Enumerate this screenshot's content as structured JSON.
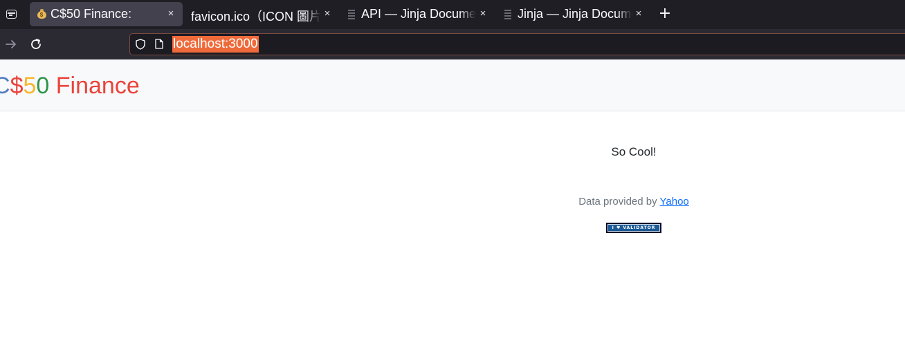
{
  "browser": {
    "tabs": [
      {
        "title": "C$50 Finance:",
        "active": true,
        "favicon": "money-bag-icon"
      },
      {
        "title": "favicon.ico（ICON 圖片）",
        "active": false,
        "favicon": "none"
      },
      {
        "title": "API — Jinja Documentation",
        "active": false,
        "favicon": "document-icon"
      },
      {
        "title": "Jinja — Jinja Documentation",
        "active": false,
        "favicon": "document-icon"
      }
    ],
    "new_tab_symbol": "+",
    "close_symbol": "×",
    "url": "localhost:3000"
  },
  "page": {
    "brand": {
      "c": "C",
      "dollar": "$",
      "five": "5",
      "zero": "0",
      "rest": " Finance"
    },
    "message": "So Cool!",
    "footer": {
      "text": "Data provided by ",
      "link": "Yahoo"
    },
    "validator_badge": "I ♥ VALIDATOR"
  },
  "colors": {
    "brand_blue": "#537fbe",
    "brand_red": "#ea433b",
    "brand_yellow": "#f5b82e",
    "brand_green": "#2e944b",
    "url_highlight": "#ef6a3a"
  }
}
